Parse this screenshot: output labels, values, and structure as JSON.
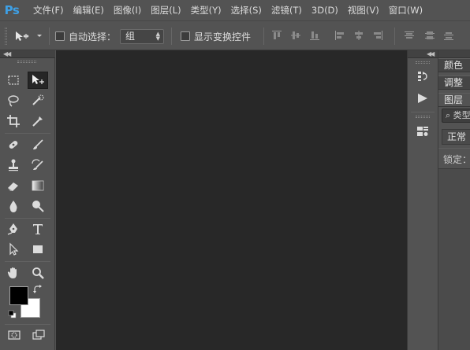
{
  "app": {
    "logo": "Ps",
    "accent_color": "#3ea0e6"
  },
  "menu": {
    "items": [
      "文件(F)",
      "编辑(E)",
      "图像(I)",
      "图层(L)",
      "类型(Y)",
      "选择(S)",
      "滤镜(T)",
      "3D(D)",
      "视图(V)",
      "窗口(W)"
    ]
  },
  "options_bar": {
    "tool_icon": "move-tool-icon",
    "auto_select_label": "自动选择：",
    "auto_select_checked": false,
    "auto_select_target": "组",
    "show_transform_label": "显示变换控件",
    "show_transform_checked": false
  },
  "toolbox": {
    "foreground_color": "#000000",
    "background_color": "#ffffff",
    "tools": [
      "rectangular-marquee-icon",
      "move-icon",
      "lasso-icon",
      "quick-selection-icon",
      "crop-icon",
      "eyedropper-icon",
      "healing-brush-icon",
      "brush-icon",
      "clone-stamp-icon",
      "history-brush-icon",
      "eraser-icon",
      "gradient-icon",
      "blur-icon",
      "dodge-icon",
      "pen-icon",
      "type-icon",
      "path-selection-icon",
      "rectangle-icon",
      "hand-icon",
      "zoom-icon"
    ]
  },
  "canvas": {
    "background": "#282828"
  },
  "right_panel": {
    "tabs": [
      "颜色",
      "调整",
      "图层"
    ],
    "search_placeholder": "类型",
    "blend_mode": "正常",
    "lock_label": "锁定："
  }
}
